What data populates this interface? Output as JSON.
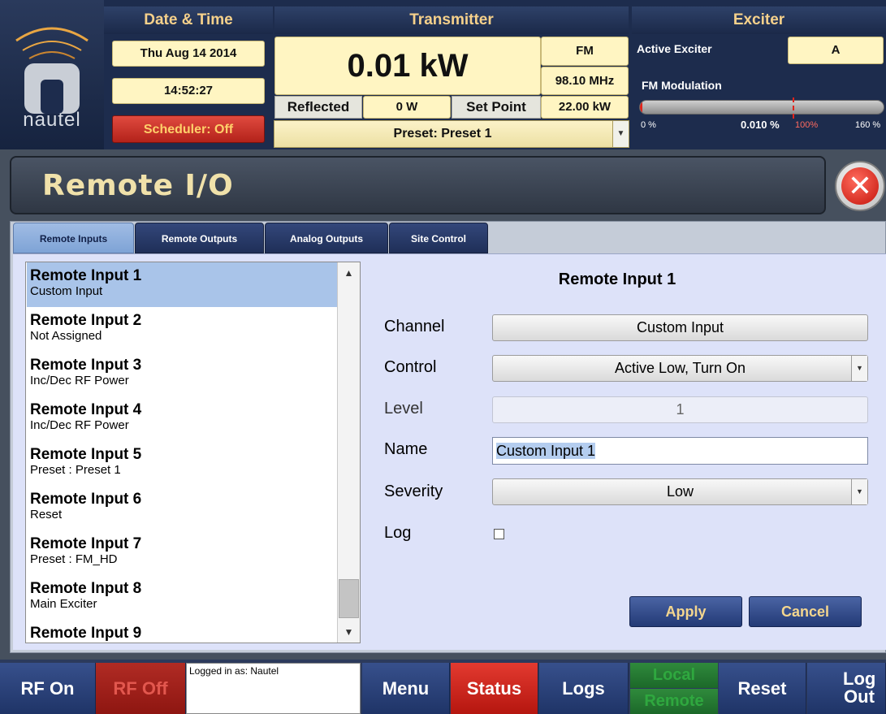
{
  "header": {
    "brand": "nautel",
    "date_time_title": "Date & Time",
    "date": "Thu Aug 14 2014",
    "time": "14:52:27",
    "scheduler": "Scheduler: Off",
    "transmitter_title": "Transmitter",
    "power": "0.01 kW",
    "mode": "FM",
    "frequency": "98.10 MHz",
    "reflected_label": "Reflected",
    "reflected_value": "0 W",
    "setpoint_label": "Set Point",
    "setpoint_value": "22.00 kW",
    "preset": "Preset: Preset 1",
    "exciter_title": "Exciter",
    "active_exciter_label": "Active Exciter",
    "active_exciter_value": "A",
    "fm_mod_label": "FM Modulation",
    "fm_mod_value": "0.010 %",
    "fm_mod_fraction": 6.25e-05,
    "mod_scale_min": "0 %",
    "mod_scale_mark": "100%",
    "mod_scale_max": "160 %"
  },
  "page": {
    "title": "Remote I/O"
  },
  "tabs": [
    {
      "label": "Remote Inputs",
      "active": true
    },
    {
      "label": "Remote Outputs",
      "active": false
    },
    {
      "label": "Analog Outputs",
      "active": false
    },
    {
      "label": "Site Control",
      "active": false
    }
  ],
  "inputs": [
    {
      "title": "Remote Input 1",
      "subtitle": "Custom Input"
    },
    {
      "title": "Remote Input 2",
      "subtitle": "Not Assigned"
    },
    {
      "title": "Remote Input 3",
      "subtitle": "Inc/Dec RF Power"
    },
    {
      "title": "Remote Input 4",
      "subtitle": "Inc/Dec RF Power"
    },
    {
      "title": "Remote Input 5",
      "subtitle": "Preset : Preset 1"
    },
    {
      "title": "Remote Input 6",
      "subtitle": "Reset"
    },
    {
      "title": "Remote Input 7",
      "subtitle": "Preset : FM_HD"
    },
    {
      "title": "Remote Input 8",
      "subtitle": "Main Exciter"
    },
    {
      "title": "Remote Input 9",
      "subtitle": ""
    }
  ],
  "detail": {
    "title": "Remote Input 1",
    "channel_label": "Channel",
    "channel_value": "Custom Input",
    "control_label": "Control",
    "control_value": "Active Low, Turn On",
    "level_label": "Level",
    "level_value": "1",
    "name_label": "Name",
    "name_value": "Custom Input 1",
    "severity_label": "Severity",
    "severity_value": "Low",
    "log_label": "Log",
    "log_checked": false,
    "apply": "Apply",
    "cancel": "Cancel"
  },
  "footer": {
    "rf_on": "RF On",
    "rf_off": "RF Off",
    "logged_in": "Logged in as: Nautel",
    "menu": "Menu",
    "status": "Status",
    "logs": "Logs",
    "local": "Local",
    "remote": "Remote",
    "reset": "Reset",
    "logout": "Log Out"
  },
  "icons": {
    "close": "close-icon",
    "scroll_up": "chevron-up-icon",
    "scroll_down": "chevron-down-icon",
    "dropdown": "chevron-down-icon"
  },
  "colors": {
    "accent_gold": "#f6d18b",
    "header_navy": "#1d2c4d",
    "alert_red": "#c4140a",
    "selection_blue": "#a9c4e9"
  }
}
